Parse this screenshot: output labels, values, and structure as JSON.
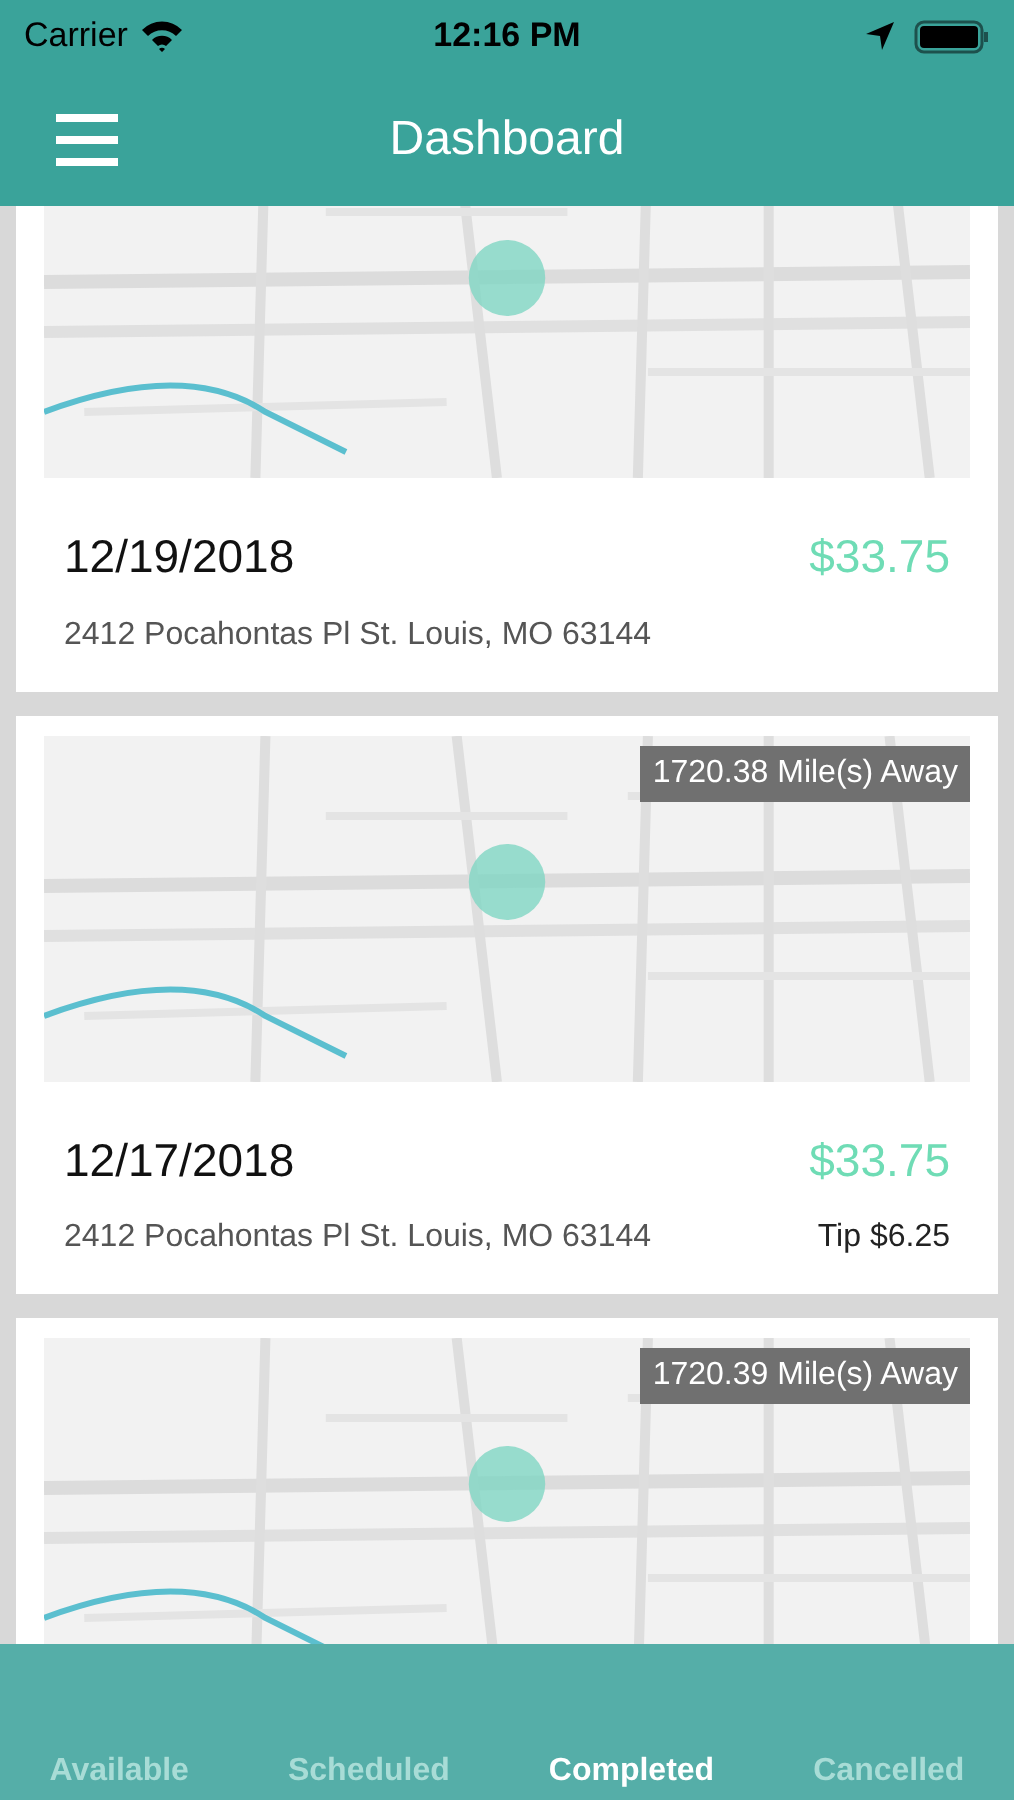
{
  "status_bar": {
    "carrier": "Carrier",
    "time": "12:16 PM"
  },
  "nav_bar": {
    "title": "Dashboard"
  },
  "cards": [
    {
      "date": "12/19/2018",
      "amount": "$33.75",
      "address": "2412 Pocahontas Pl St. Louis, MO 63144"
    },
    {
      "distance": "1720.38 Mile(s) Away",
      "date": "12/17/2018",
      "amount": "$33.75",
      "address": "2412 Pocahontas Pl St. Louis, MO 63144",
      "tip": "Tip $6.25"
    },
    {
      "distance": "1720.39 Mile(s) Away"
    }
  ],
  "tabs": [
    {
      "label": "Available",
      "selected": false
    },
    {
      "label": "Scheduled",
      "selected": false
    },
    {
      "label": "Completed",
      "selected": true
    },
    {
      "label": "Cancelled",
      "selected": false
    }
  ]
}
